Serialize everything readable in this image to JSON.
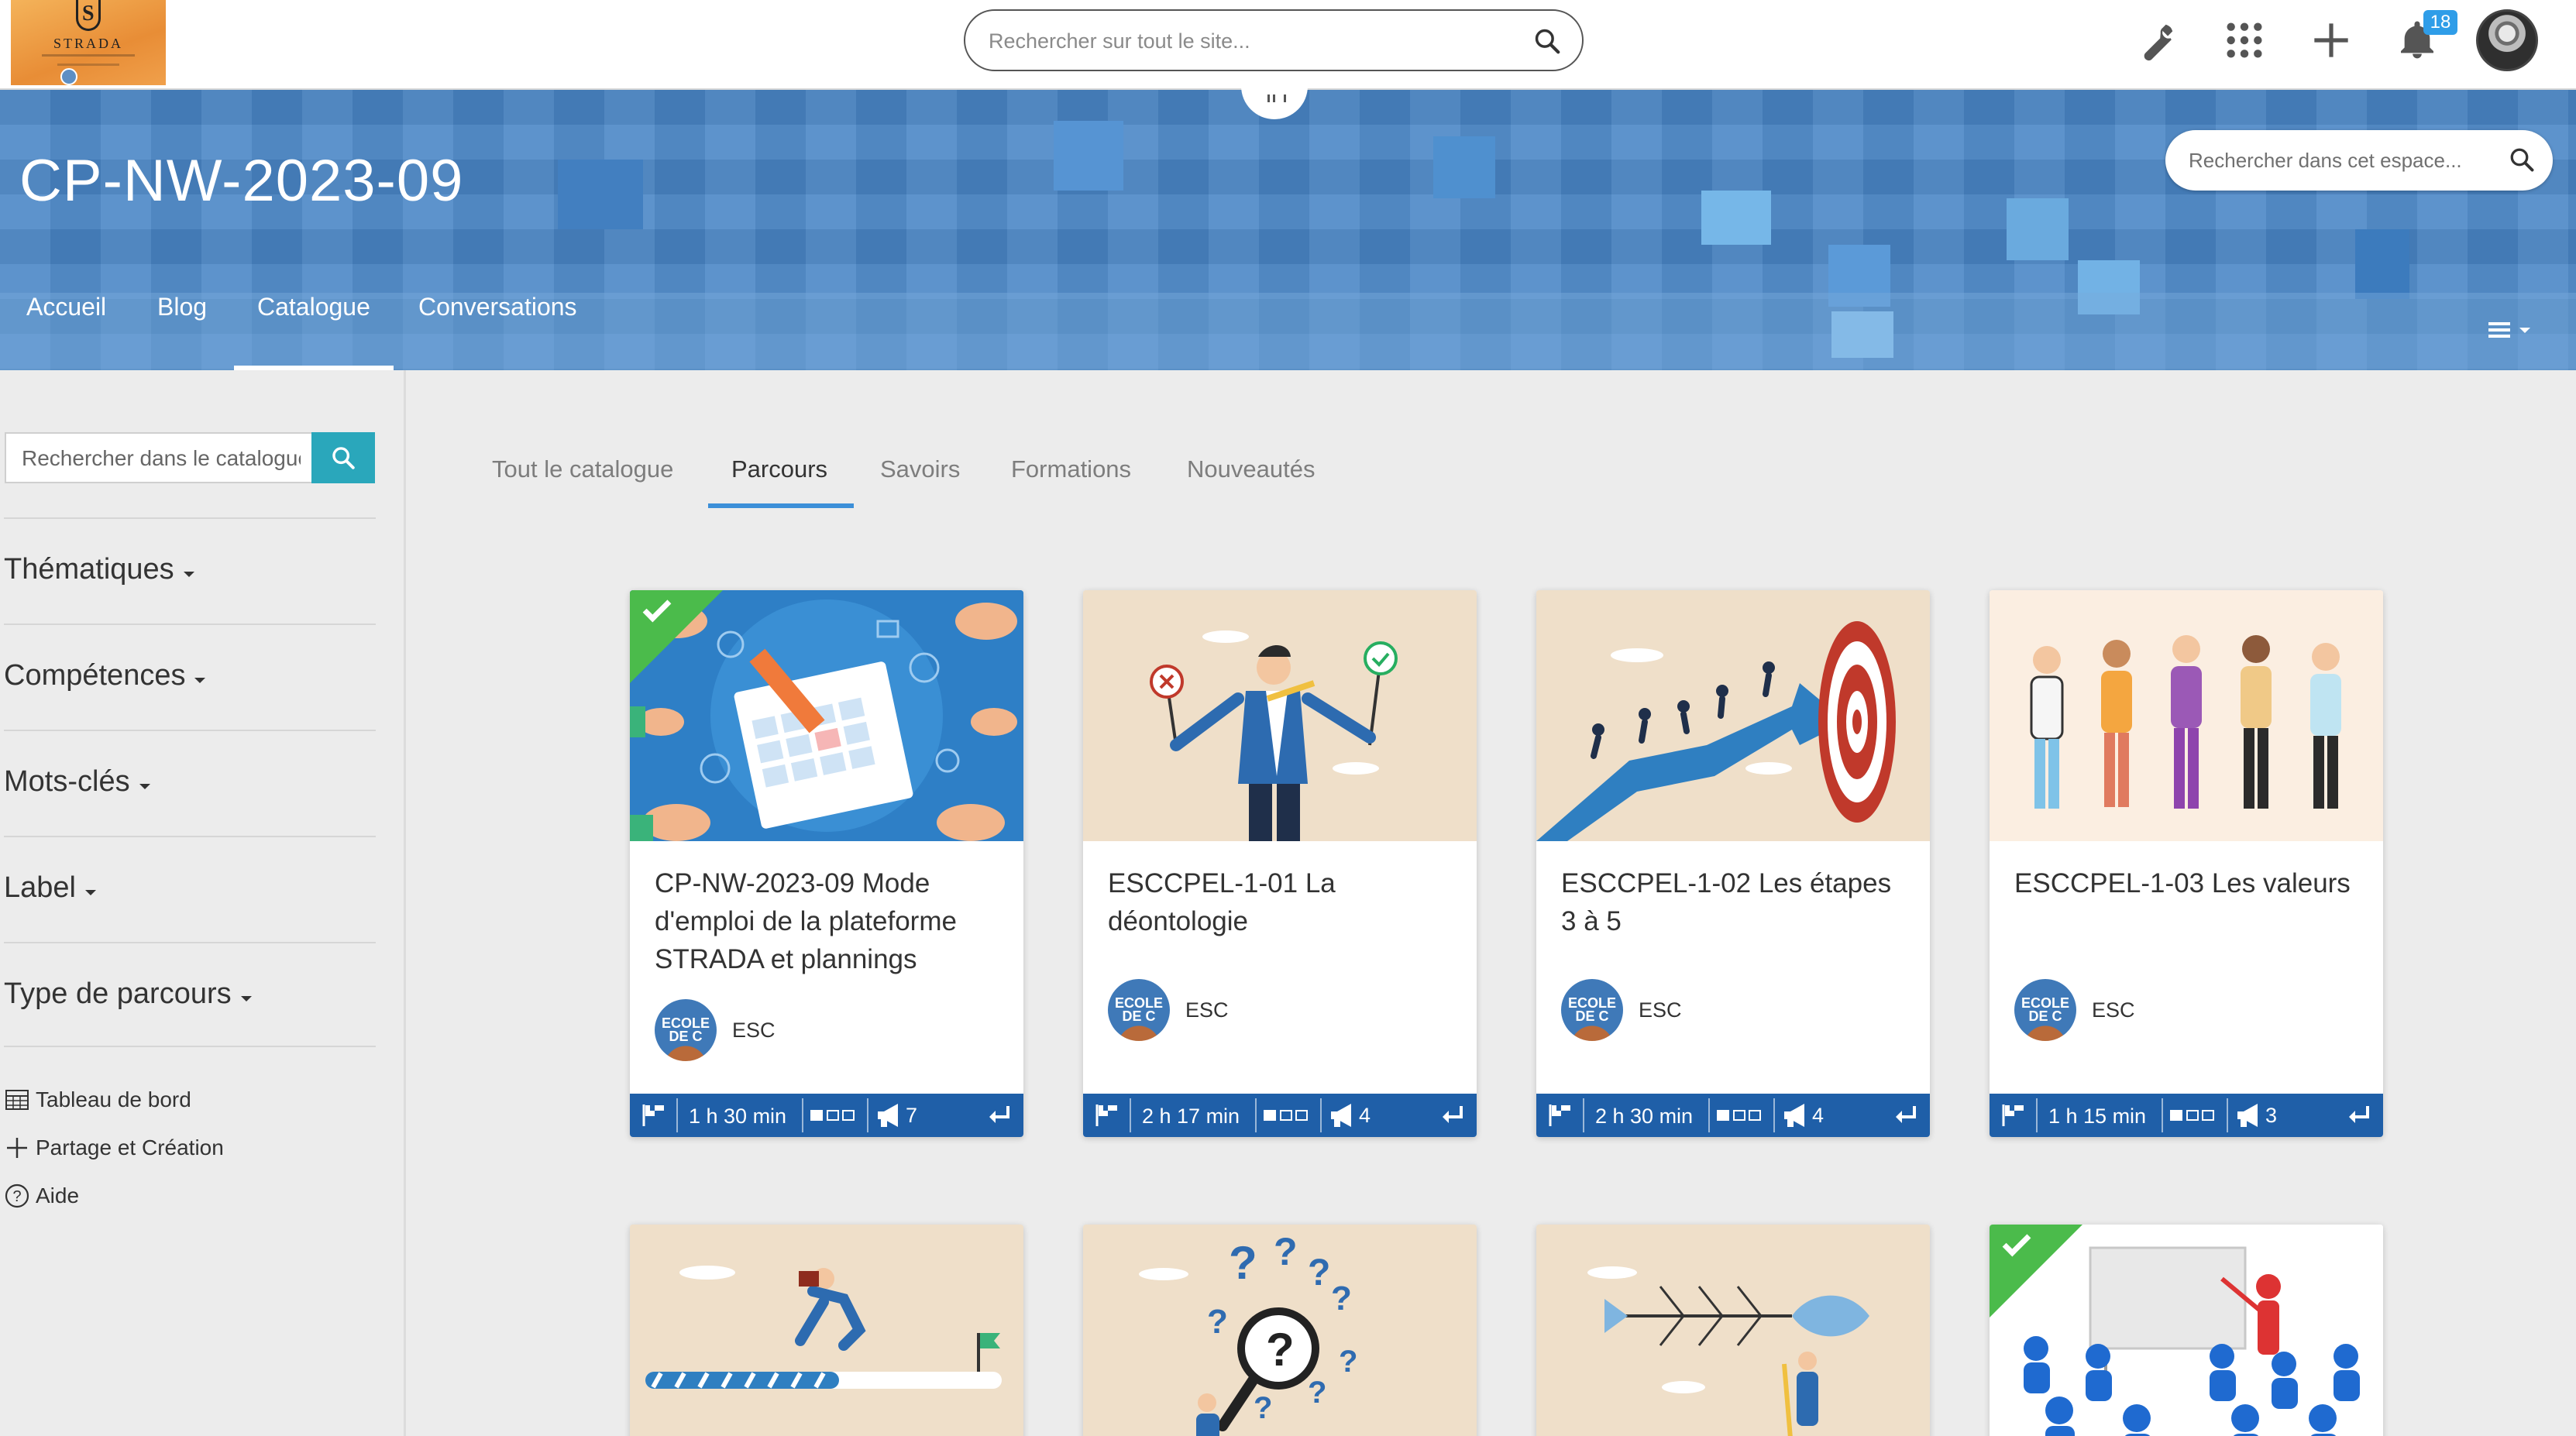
{
  "topbar": {
    "logo_text": "STRADA",
    "search_placeholder": "Rechercher sur tout le site...",
    "notification_count": "18",
    "icons": [
      "wrench-icon",
      "apps-grid-icon",
      "plus-icon",
      "bell-icon"
    ]
  },
  "space": {
    "title": "CP-NW-2023-09",
    "search_placeholder": "Rechercher dans cet espace...",
    "nav": [
      {
        "label": "Accueil"
      },
      {
        "label": "Blog"
      },
      {
        "label": "Catalogue"
      },
      {
        "label": "Conversations"
      }
    ],
    "active_nav": "Catalogue"
  },
  "sidebar": {
    "search_placeholder": "Rechercher dans le catalogue",
    "filters": [
      {
        "label": "Thématiques"
      },
      {
        "label": "Compétences"
      },
      {
        "label": "Mots-clés"
      },
      {
        "label": "Label"
      },
      {
        "label": "Type de parcours"
      }
    ],
    "links": [
      {
        "label": "Tableau de bord",
        "icon": "table-icon"
      },
      {
        "label": "Partage et Création",
        "icon": "plus-icon"
      },
      {
        "label": "Aide",
        "icon": "help-circle-icon"
      }
    ]
  },
  "content": {
    "tabs": [
      {
        "label": "Tout le catalogue"
      },
      {
        "label": "Parcours"
      },
      {
        "label": "Savoirs"
      },
      {
        "label": "Formations"
      },
      {
        "label": "Nouveautés"
      }
    ],
    "active_tab": "Parcours",
    "cards": [
      {
        "title": "CP-NW-2023-09 Mode d'emploi de la plateforme STRADA et plannings",
        "author": "ESC",
        "author_logo": "ECOLE DE C",
        "duration": "1 h 30 min",
        "announcements": "7",
        "completed": true,
        "image": "planning-hands"
      },
      {
        "title": "ESCCPEL-1-01 La déontologie",
        "author": "ESC",
        "author_logo": "ECOLE DE C",
        "duration": "2 h 17 min",
        "announcements": "4",
        "completed": false,
        "image": "man-choice-signs"
      },
      {
        "title": "ESCCPEL-1-02 Les étapes 3 à 5",
        "author": "ESC",
        "author_logo": "ECOLE DE C",
        "duration": "2 h 30 min",
        "announcements": "4",
        "completed": false,
        "image": "arrow-target"
      },
      {
        "title": "ESCCPEL-1-03 Les valeurs",
        "author": "ESC",
        "author_logo": "ECOLE DE C",
        "duration": "1 h 15 min",
        "announcements": "3",
        "completed": false,
        "image": "diverse-people"
      },
      {
        "image": "runner-progress",
        "completed": false
      },
      {
        "image": "magnifier-questions",
        "completed": false
      },
      {
        "image": "fishbone",
        "completed": false
      },
      {
        "image": "classroom-presentation",
        "completed": true
      }
    ]
  },
  "colors": {
    "accent": "#3c8fd8",
    "banner": "#4a86c6",
    "card_footer": "#1f5fa8",
    "search_button": "#2aa7bb",
    "completed": "#4bbb4b"
  }
}
